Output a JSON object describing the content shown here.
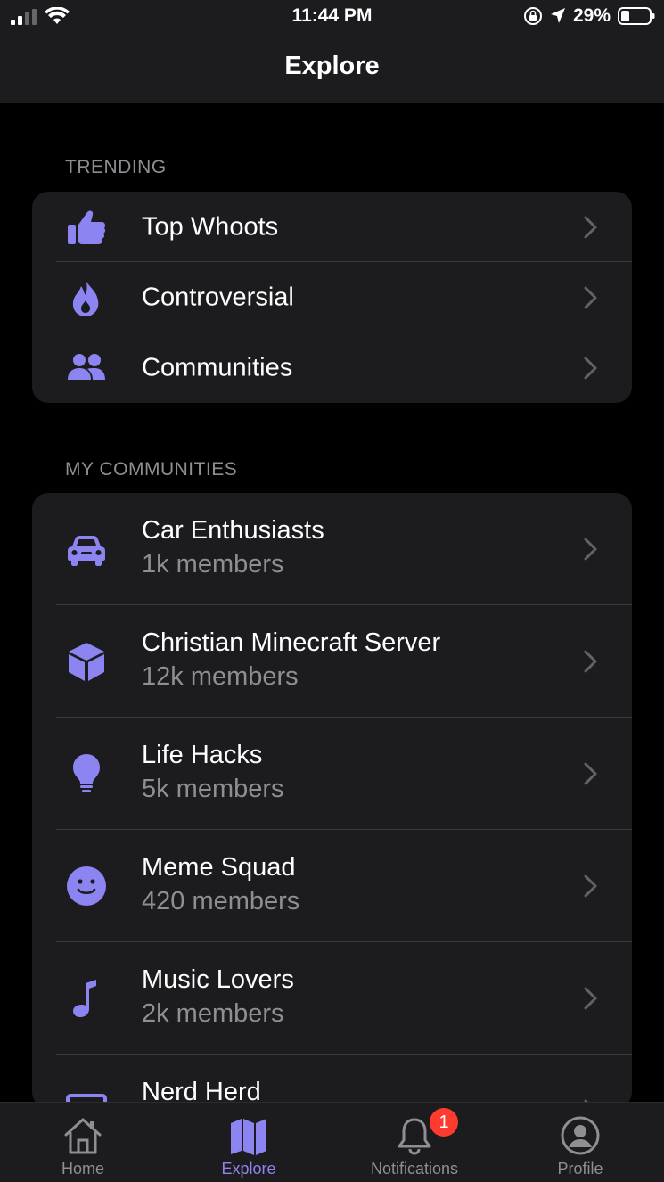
{
  "status_bar": {
    "time": "11:44 PM",
    "battery": "29%"
  },
  "nav": {
    "title": "Explore"
  },
  "trending": {
    "header": "TRENDING",
    "items": [
      {
        "label": "Top Whoots",
        "icon": "thumbs-up-icon"
      },
      {
        "label": "Controversial",
        "icon": "flame-icon"
      },
      {
        "label": "Communities",
        "icon": "people-icon"
      }
    ]
  },
  "my_communities": {
    "header": "MY COMMUNITIES",
    "items": [
      {
        "label": "Car Enthusiasts",
        "members": "1k members",
        "icon": "car-icon"
      },
      {
        "label": "Christian Minecraft Server",
        "members": "12k members",
        "icon": "cube-icon"
      },
      {
        "label": "Life Hacks",
        "members": "5k members",
        "icon": "lightbulb-icon"
      },
      {
        "label": "Meme Squad",
        "members": "420 members",
        "icon": "smiley-icon"
      },
      {
        "label": "Music Lovers",
        "members": "2k members",
        "icon": "music-note-icon"
      },
      {
        "label": "Nerd Herd",
        "members": "",
        "icon": "monitor-icon"
      }
    ]
  },
  "tabbar": {
    "tabs": [
      {
        "label": "Home",
        "icon": "home-icon"
      },
      {
        "label": "Explore",
        "icon": "map-icon"
      },
      {
        "label": "Notifications",
        "icon": "bell-icon",
        "badge": "1"
      },
      {
        "label": "Profile",
        "icon": "person-circle-icon"
      }
    ]
  },
  "colors": {
    "accent": "#8c84f0",
    "background": "#000000",
    "card": "#1c1c1e",
    "secondary_text": "#8e8e93",
    "badge": "#ff3b30"
  }
}
